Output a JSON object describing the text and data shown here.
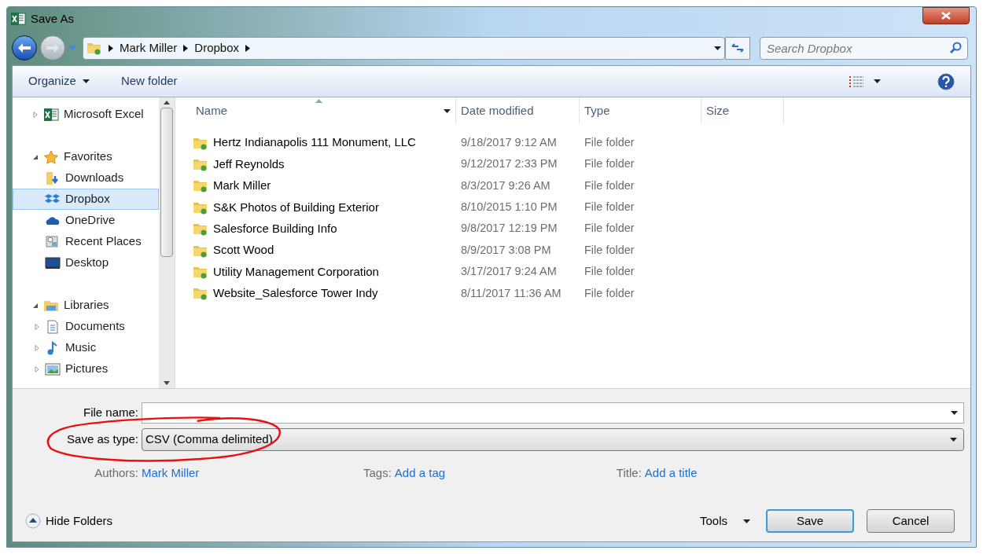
{
  "window": {
    "title": "Save As"
  },
  "breadcrumb": [
    "Mark Miller",
    "Dropbox"
  ],
  "search": {
    "placeholder": "Search Dropbox"
  },
  "toolbar": {
    "organize": "Organize",
    "new_folder": "New folder"
  },
  "tree": [
    {
      "label": "Microsoft Excel",
      "expanded": false,
      "selected": false
    },
    {
      "label": "Favorites",
      "expanded": true,
      "selected": false,
      "children": [
        {
          "label": "Downloads",
          "selected": false
        },
        {
          "label": "Dropbox",
          "selected": true
        },
        {
          "label": "OneDrive",
          "selected": false
        },
        {
          "label": "Recent Places",
          "selected": false
        },
        {
          "label": "Desktop",
          "selected": false
        }
      ]
    },
    {
      "label": "Libraries",
      "expanded": true,
      "selected": false,
      "children": [
        {
          "label": "Documents",
          "expanded": false,
          "selected": false
        },
        {
          "label": "Music",
          "expanded": false,
          "selected": false
        },
        {
          "label": "Pictures",
          "expanded": false,
          "selected": false
        }
      ]
    }
  ],
  "table": {
    "columns": [
      "Name",
      "Date modified",
      "Type",
      "Size"
    ],
    "rows": [
      {
        "name": "Hertz Indianapolis 111 Monument, LLC",
        "date": "9/18/2017 9:12 AM",
        "type": "File folder"
      },
      {
        "name": "Jeff Reynolds",
        "date": "9/12/2017 2:33 PM",
        "type": "File folder"
      },
      {
        "name": "Mark Miller",
        "date": "8/3/2017 9:26 AM",
        "type": "File folder"
      },
      {
        "name": "S&K Photos of Building Exterior",
        "date": "8/10/2015 1:10 PM",
        "type": "File folder"
      },
      {
        "name": "Salesforce Building Info",
        "date": "9/8/2017 12:19 PM",
        "type": "File folder"
      },
      {
        "name": "Scott Wood",
        "date": "8/9/2017 3:08 PM",
        "type": "File folder"
      },
      {
        "name": "Utility Management Corporation",
        "date": "3/17/2017 9:24 AM",
        "type": "File folder"
      },
      {
        "name": "Website_Salesforce Tower Indy",
        "date": "8/11/2017 11:36 AM",
        "type": "File folder"
      }
    ]
  },
  "form": {
    "file_name_label": "File name:",
    "save_type_label": "Save as type:",
    "save_type": "CSV (Comma delimited)",
    "authors_label": "Authors:",
    "authors": "Mark Miller",
    "tags_label": "Tags:",
    "tags": "Add a tag",
    "title_label": "Title:",
    "title": "Add a title"
  },
  "footer": {
    "hide_folders": "Hide Folders",
    "tools": "Tools",
    "save": "Save",
    "cancel": "Cancel"
  }
}
